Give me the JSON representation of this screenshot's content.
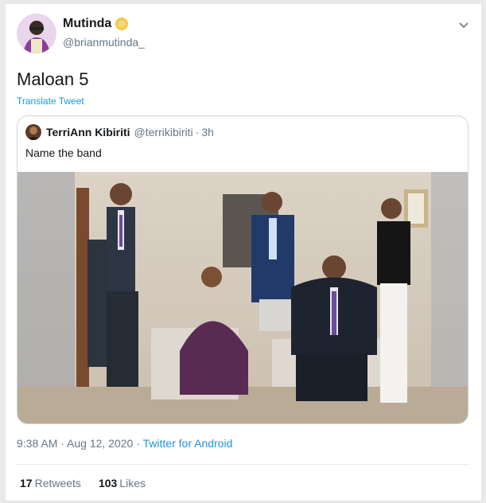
{
  "tweet": {
    "display_name": "Mutinda",
    "handle": "@brianmutinda_",
    "text": "Maloan 5",
    "translate_label": "Translate Tweet",
    "timestamp": "9:38 AM · Aug 12, 2020 · ",
    "source": "Twitter for Android"
  },
  "quoted": {
    "display_name": "TerriAnn Kibiriti",
    "handle": "@terrikibiriti",
    "separator": "·",
    "time": "3h",
    "text": "Name the band"
  },
  "stats": {
    "retweets_count": "17",
    "retweets_label": "Retweets",
    "likes_count": "103",
    "likes_label": "Likes"
  },
  "colors": {
    "link": "#1b95e0",
    "muted": "#657786",
    "verified": "#f5c84c"
  }
}
